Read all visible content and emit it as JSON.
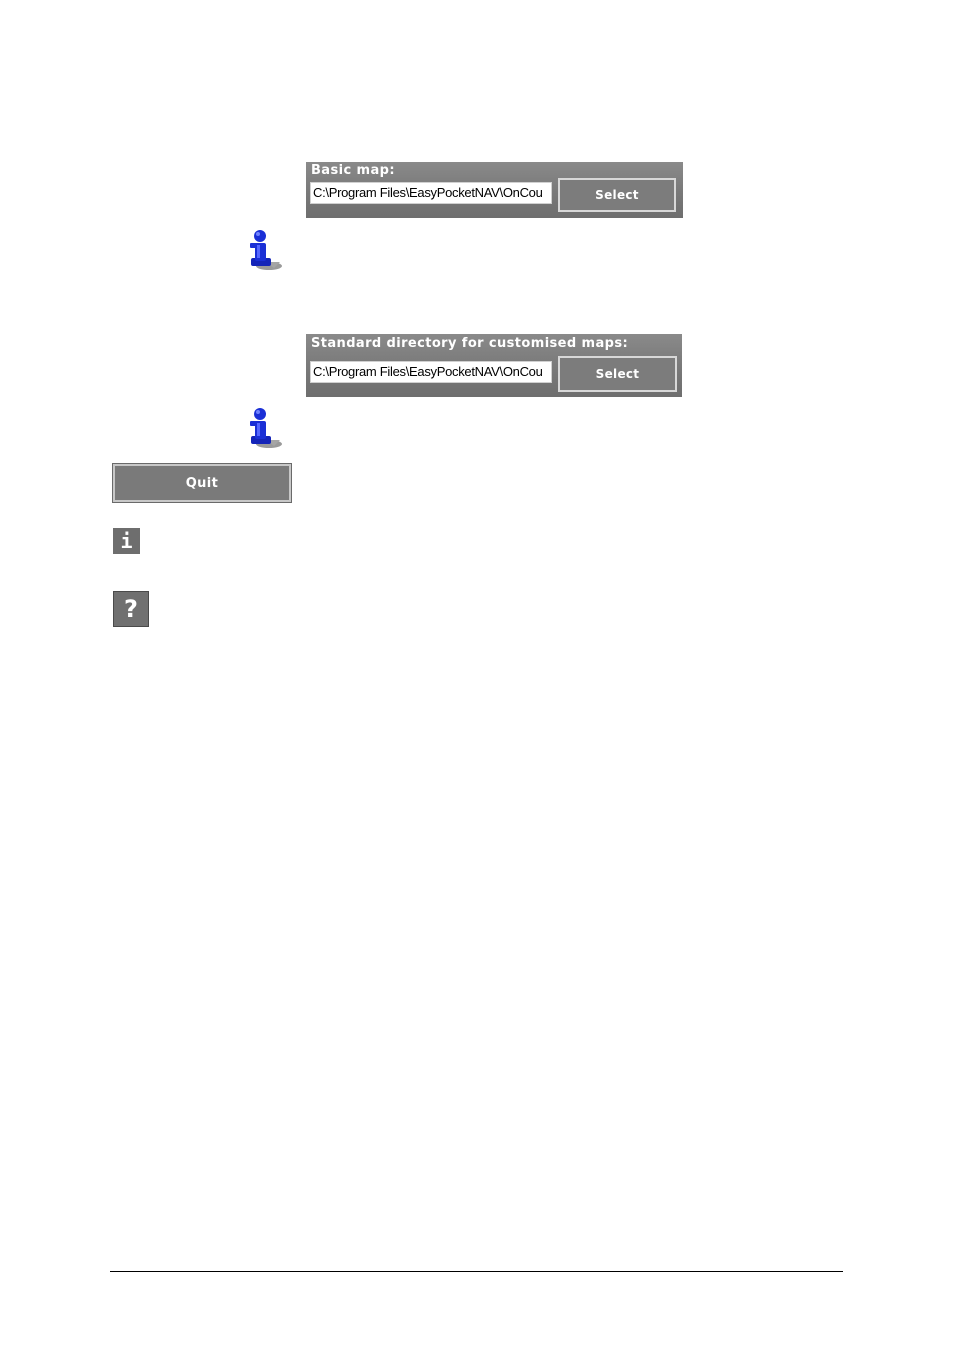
{
  "basic_map": {
    "title": "Basic map:",
    "path_value": "C:\\Program Files\\EasyPocketNAV\\OnCou",
    "select_label": "Select"
  },
  "custom_maps": {
    "title": "Standard directory for customised maps:",
    "path_value": "C:\\Program Files\\EasyPocketNAV\\OnCou",
    "select_label": "Select"
  },
  "quit_label": "Quit",
  "info_glyph": "i",
  "help_glyph": "?",
  "icons": {
    "note_figure": "info-figure-icon",
    "info": "info-icon",
    "help": "help-icon"
  },
  "colors": {
    "panel": "#7a7a7a",
    "figure_blue": "#1a2fd6"
  }
}
